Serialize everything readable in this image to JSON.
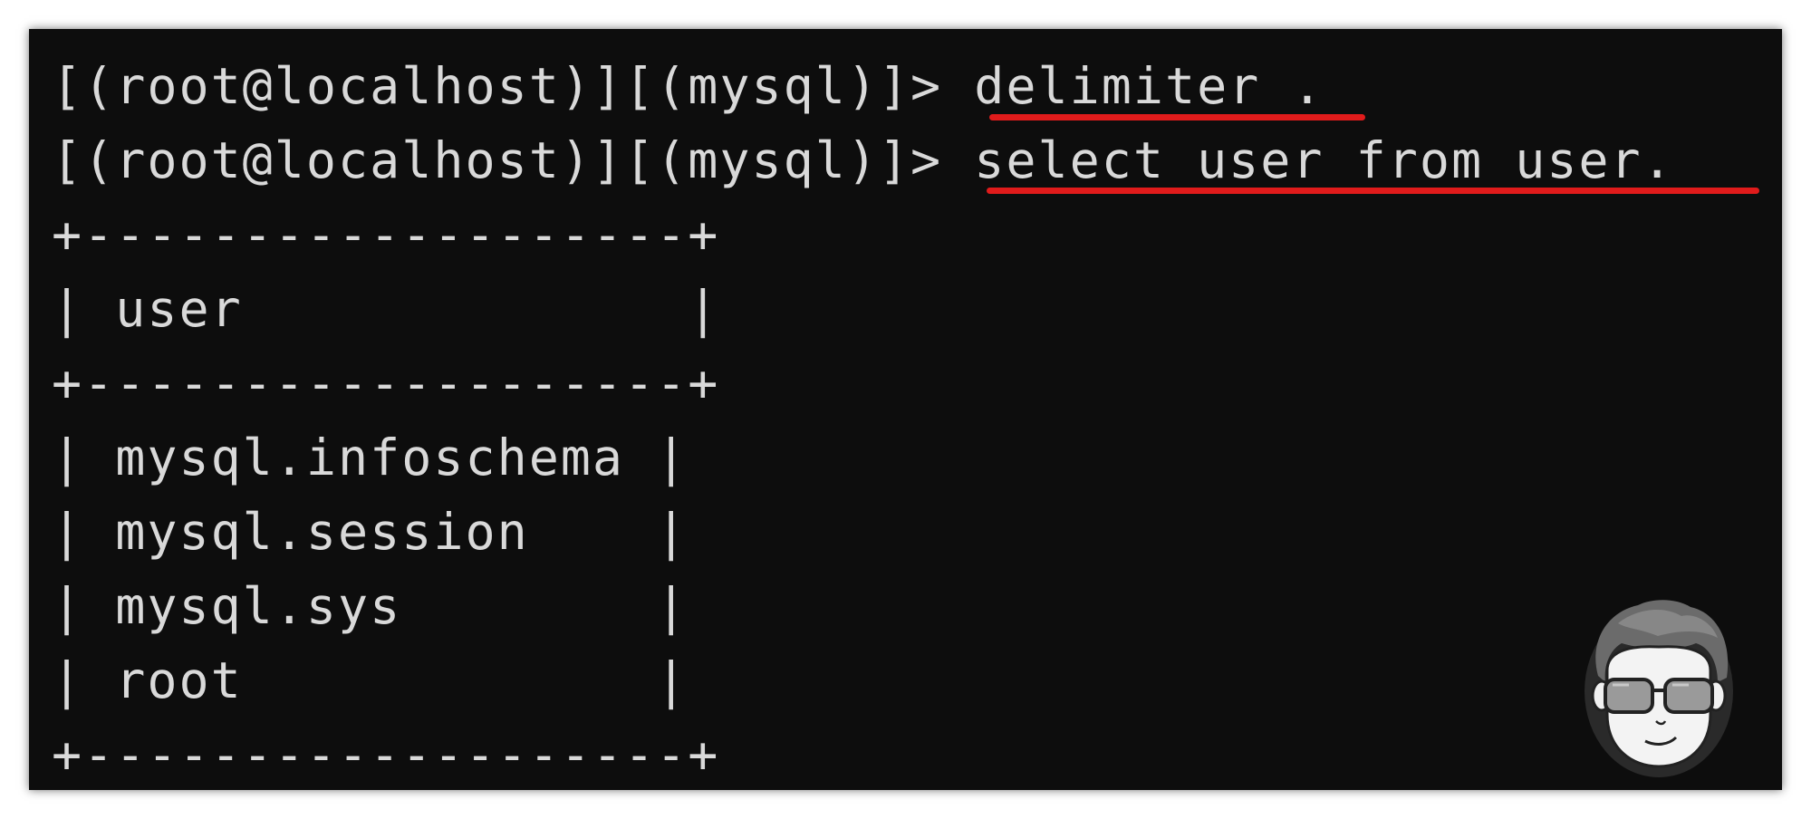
{
  "terminal": {
    "commands": [
      {
        "prompt": "[(root@localhost)][(mysql)]>",
        "input": " delimiter ."
      },
      {
        "prompt": "[(root@localhost)][(mysql)]>",
        "input": " select user from user."
      }
    ],
    "table": {
      "border": "+-------------------+",
      "header": "| user              |",
      "rows": [
        "| mysql.infoschema |",
        "| mysql.session    |",
        "| mysql.sys        |",
        "| root             |"
      ]
    }
  },
  "colors": {
    "background": "#0d0d0d",
    "text": "#d9d9d9",
    "highlight": "#e01b1b"
  },
  "watermark": {
    "icon": "avatar-sunglasses-icon"
  }
}
